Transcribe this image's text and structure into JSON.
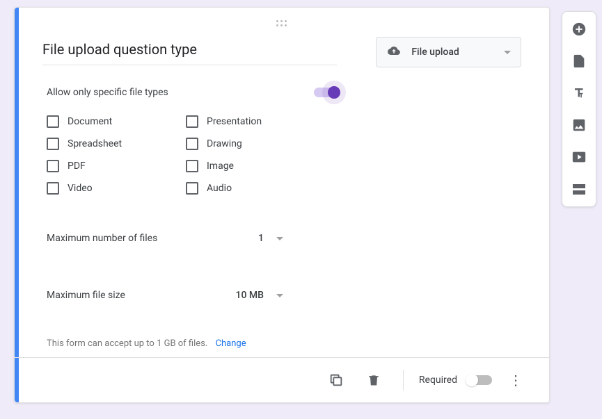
{
  "question": {
    "title": "File upload question type"
  },
  "typeSelector": {
    "label": "File upload"
  },
  "allowSpecific": {
    "label": "Allow only specific file types",
    "enabled": true
  },
  "fileTypes": {
    "col1": [
      "Document",
      "Spreadsheet",
      "PDF",
      "Video"
    ],
    "col2": [
      "Presentation",
      "Drawing",
      "Image",
      "Audio"
    ]
  },
  "maxFiles": {
    "label": "Maximum number of files",
    "value": "1"
  },
  "maxSize": {
    "label": "Maximum file size",
    "value": "10 MB"
  },
  "storage": {
    "note": "This form can accept up to 1 GB of files.",
    "changeLabel": "Change"
  },
  "footer": {
    "requiredLabel": "Required",
    "requiredOn": false
  }
}
